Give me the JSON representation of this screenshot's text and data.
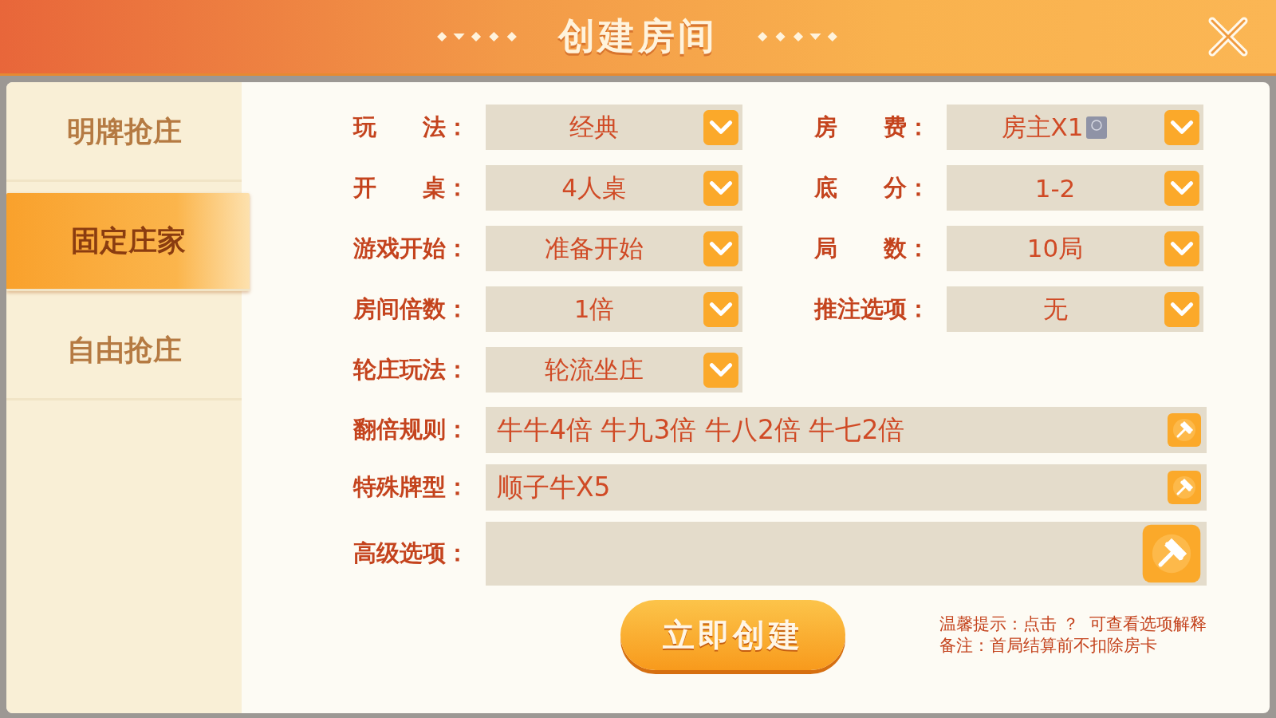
{
  "header": {
    "title": "创建房间"
  },
  "sidebar": {
    "items": [
      {
        "label": "明牌抢庄",
        "selected": false
      },
      {
        "label": "固定庄家",
        "selected": true
      },
      {
        "label": "自由抢庄",
        "selected": false
      }
    ]
  },
  "options": [
    {
      "label": "玩　　法：",
      "value": "经典",
      "card_icon": false
    },
    {
      "label": "房　　费：",
      "value": "房主X1",
      "card_icon": true
    },
    {
      "label": "开　　桌：",
      "value": "4人桌",
      "card_icon": false
    },
    {
      "label": "底　　分：",
      "value": "1-2",
      "card_icon": false
    },
    {
      "label": "游戏开始：",
      "value": "准备开始",
      "card_icon": false
    },
    {
      "label": "局　　数：",
      "value": "10局",
      "card_icon": false
    },
    {
      "label": "房间倍数：",
      "value": "1倍",
      "card_icon": false
    },
    {
      "label": "推注选项：",
      "value": "无",
      "card_icon": false
    },
    {
      "label": "轮庄玩法：",
      "value": "轮流坐庄",
      "card_icon": false
    }
  ],
  "rules": [
    {
      "label": "翻倍规则：",
      "value": "牛牛4倍 牛九3倍 牛八2倍 牛七2倍",
      "kind": "small"
    },
    {
      "label": "特殊牌型：",
      "value": "顺子牛X5",
      "kind": "small"
    },
    {
      "label": "高级选项：",
      "kind": "large"
    }
  ],
  "create_button": "立即创建",
  "hints": [
    "温馨提示：点击 ？  可查看选项解释",
    "备注：首局结算前不扣除房卡"
  ]
}
